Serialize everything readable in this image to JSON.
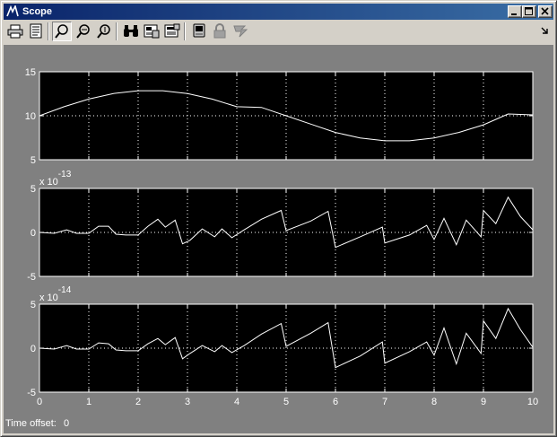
{
  "window": {
    "title": "Scope"
  },
  "toolbar": {
    "icons": [
      "printer-icon",
      "parameters-icon",
      "zoom-icon",
      "zoom-x-icon",
      "zoom-y-icon",
      "binoculars-icon",
      "save-axes-icon",
      "restore-axes-icon",
      "floating-scope-icon",
      "lock-icon",
      "signal-selection-icon"
    ],
    "pressed": "zoom-icon"
  },
  "status": {
    "label": "Time offset:",
    "value": "0"
  },
  "chart_data": [
    {
      "type": "line",
      "title": "",
      "xlim": [
        0,
        10
      ],
      "ylim": [
        5,
        15
      ],
      "xticks": [
        "0",
        "1",
        "2",
        "3",
        "4",
        "5",
        "6",
        "7",
        "8",
        "9",
        "10"
      ],
      "yticks": [
        "5",
        "10",
        "15"
      ],
      "show_xtick_labels": false,
      "exponent": "",
      "grid": true,
      "background": "#000000",
      "line_color": "#ffffff",
      "x": [
        0,
        0.5,
        1,
        1.5,
        2,
        2.5,
        3,
        3.5,
        4,
        4.5,
        5,
        5.5,
        6,
        6.5,
        7,
        7.5,
        8,
        8.5,
        9,
        9.5,
        10
      ],
      "y": [
        10,
        11.03,
        11.9,
        12.53,
        12.85,
        12.85,
        12.53,
        11.9,
        11.03,
        10.95,
        10,
        9.05,
        8.1,
        7.47,
        7.15,
        7.15,
        7.47,
        8.1,
        8.97,
        10.2,
        10.1
      ]
    },
    {
      "type": "line",
      "title": "",
      "xlim": [
        0,
        10
      ],
      "ylim": [
        -5,
        5
      ],
      "xticks": [
        "0",
        "1",
        "2",
        "3",
        "4",
        "5",
        "6",
        "7",
        "8",
        "9",
        "10"
      ],
      "yticks": [
        "-5",
        "0",
        "5"
      ],
      "show_xtick_labels": false,
      "exponent": "-13",
      "grid": true,
      "background": "#000000",
      "line_color": "#ffffff",
      "x": [
        0,
        0.3,
        0.55,
        0.75,
        1.0,
        1.2,
        1.4,
        1.55,
        1.75,
        2.0,
        2.2,
        2.4,
        2.55,
        2.75,
        2.9,
        3.05,
        3.3,
        3.55,
        3.7,
        3.9,
        4.15,
        4.5,
        4.9,
        5.0,
        5.5,
        5.85,
        6.0,
        6.5,
        6.95,
        7.0,
        7.5,
        7.85,
        8.0,
        8.2,
        8.45,
        8.65,
        8.95,
        9.0,
        9.25,
        9.5,
        9.75,
        10
      ],
      "y": [
        0,
        -0.1,
        0.3,
        -0.1,
        -0.1,
        0.7,
        0.7,
        -0.2,
        -0.3,
        -0.3,
        0.7,
        1.5,
        0.6,
        1.4,
        -1.3,
        -0.9,
        0.4,
        -0.5,
        0.4,
        -0.6,
        0.3,
        1.5,
        2.5,
        0.2,
        1.3,
        2.4,
        -1.7,
        -0.5,
        0.6,
        -1.2,
        -0.3,
        0.8,
        -0.8,
        1.6,
        -1.4,
        1.4,
        -0.5,
        2.5,
        1.0,
        4.0,
        1.8,
        0.3
      ]
    },
    {
      "type": "line",
      "title": "",
      "xlim": [
        0,
        10
      ],
      "ylim": [
        -5,
        5
      ],
      "xticks": [
        "0",
        "1",
        "2",
        "3",
        "4",
        "5",
        "6",
        "7",
        "8",
        "9",
        "10"
      ],
      "yticks": [
        "-5",
        "0",
        "5"
      ],
      "show_xtick_labels": true,
      "exponent": "-14",
      "grid": true,
      "background": "#000000",
      "line_color": "#ffffff",
      "x": [
        0,
        0.3,
        0.55,
        0.75,
        1.0,
        1.2,
        1.4,
        1.55,
        1.75,
        2.0,
        2.2,
        2.4,
        2.55,
        2.75,
        2.9,
        3.05,
        3.3,
        3.55,
        3.7,
        3.9,
        4.15,
        4.5,
        4.9,
        5.0,
        5.5,
        5.85,
        6.0,
        6.5,
        6.95,
        7.0,
        7.5,
        7.85,
        8.0,
        8.2,
        8.45,
        8.65,
        8.95,
        9.0,
        9.25,
        9.5,
        9.75,
        10
      ],
      "y": [
        0,
        -0.1,
        0.3,
        -0.1,
        -0.1,
        0.6,
        0.5,
        -0.2,
        -0.3,
        -0.3,
        0.5,
        1.1,
        0.4,
        1.2,
        -1.2,
        -0.6,
        0.3,
        -0.4,
        0.3,
        -0.5,
        0.3,
        1.6,
        2.8,
        0.2,
        1.7,
        2.9,
        -2.2,
        -0.9,
        0.7,
        -1.7,
        -0.4,
        0.7,
        -0.8,
        2.3,
        -1.8,
        1.7,
        -0.6,
        3.1,
        1.1,
        4.5,
        2.1,
        0.1
      ]
    }
  ]
}
